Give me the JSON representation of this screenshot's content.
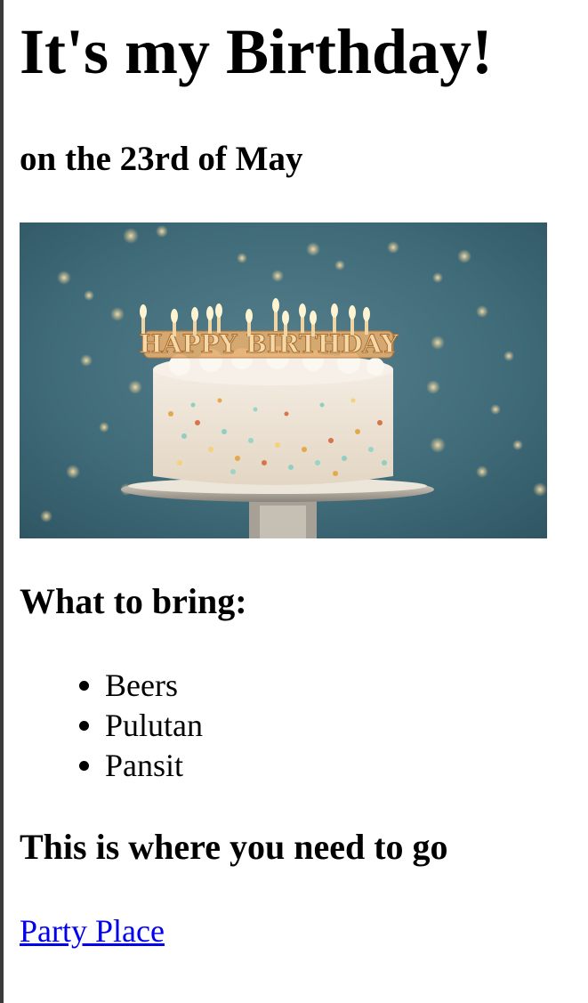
{
  "page": {
    "title": "It's my Birthday!",
    "date_line": "on the 23rd of May",
    "image": {
      "description_icon": "birthday-cake-image",
      "topper_text": "HAPPY BIRTHDAY"
    },
    "bring_heading": "What to bring:",
    "bring_items": [
      "Beers",
      "Pulutan",
      "Pansit"
    ],
    "go_heading": "This is where you need to go",
    "link": {
      "label": "Party Place",
      "color": "#0000ee"
    }
  }
}
